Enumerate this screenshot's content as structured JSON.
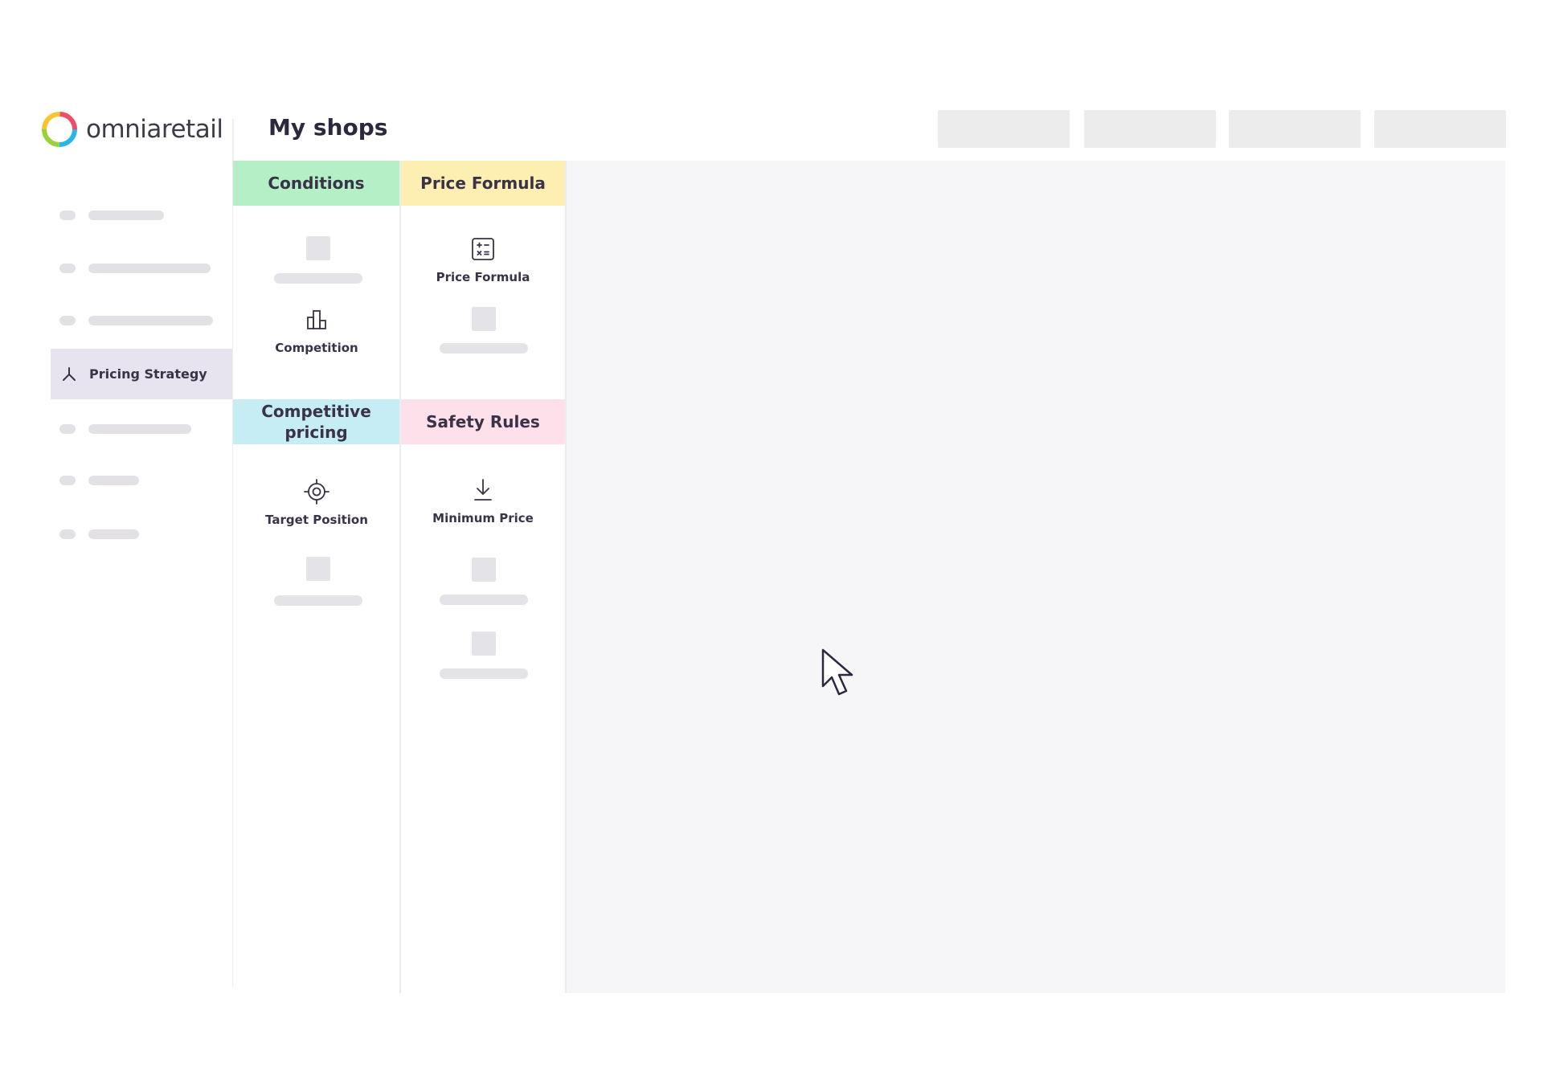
{
  "app": {
    "logo_text_a": "omnia",
    "logo_text_b": "retail"
  },
  "header": {
    "title": "My shops"
  },
  "sidebar": {
    "active_item": {
      "label": "Pricing Strategy",
      "icon": "branch-icon"
    }
  },
  "builder": {
    "sections": {
      "conditions": "Conditions",
      "price_formula": "Price Formula",
      "competitive_pricing": "Competitive pricing",
      "safety_rules": "Safety Rules"
    },
    "tools": {
      "competition": {
        "label": "Competition",
        "icon": "bar-chart-icon"
      },
      "price_formula": {
        "label": "Price Formula",
        "icon": "calculator-icon"
      },
      "target_position": {
        "label": "Target Position",
        "icon": "target-icon"
      },
      "minimum_price": {
        "label": "Minimum Price",
        "icon": "arrow-down-icon"
      }
    }
  },
  "colors": {
    "conditions": "#b4efc6",
    "price_formula": "#fdeeb2",
    "competitive_pricing": "#c6ecf4",
    "safety_rules": "#fde0ea",
    "active_nav": "#e7e4ef",
    "canvas": "#f6f6f8"
  }
}
